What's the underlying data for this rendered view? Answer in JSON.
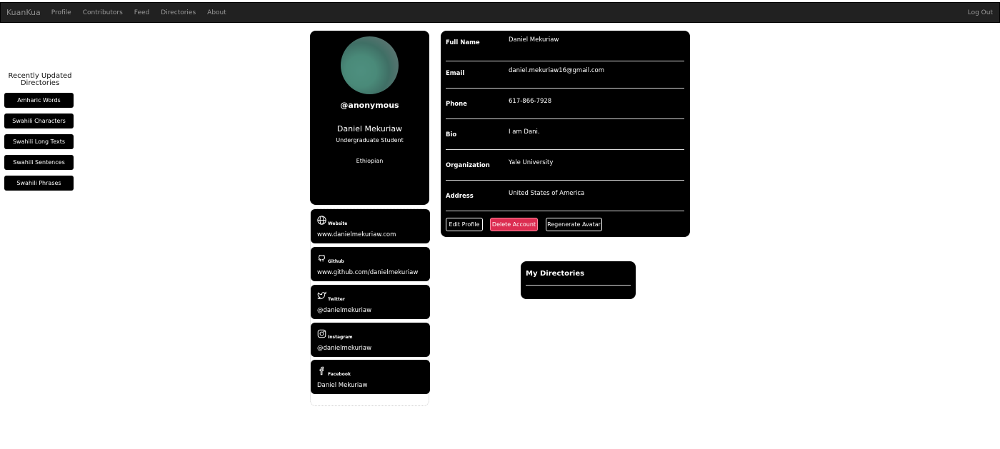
{
  "nav": {
    "brand": "KuanKua",
    "links": [
      "Profile",
      "Contributors",
      "Feed",
      "Directories",
      "About"
    ],
    "logout": "Log Out"
  },
  "sidebar": {
    "title": "Recently Updated Directories",
    "items": [
      "Amharic Words",
      "Swahili Characters",
      "Swahili Long Texts",
      "Swahili Sentences",
      "Swahili Phrases"
    ]
  },
  "profile": {
    "username": "@anonymous",
    "full_name": "Daniel Mekuriaw",
    "role": "Undergraduate Student",
    "nationality": "Ethiopian"
  },
  "social": [
    {
      "label": "Website",
      "value": "www.danielmekuriaw.com",
      "icon": "globe-icon"
    },
    {
      "label": "Github",
      "value": "www.github.com/danielmekuriaw",
      "icon": "github-icon"
    },
    {
      "label": "Twitter",
      "value": "@danielmekuriaw",
      "icon": "twitter-icon"
    },
    {
      "label": "Instagram",
      "value": "@danielmekuriaw",
      "icon": "instagram-icon"
    },
    {
      "label": "Facebook",
      "value": "Daniel Mekuriaw",
      "icon": "facebook-icon"
    }
  ],
  "details": [
    {
      "key": "Full Name",
      "value": "Daniel Mekuriaw"
    },
    {
      "key": "Email",
      "value": "daniel.mekuriaw16@gmail.com"
    },
    {
      "key": "Phone",
      "value": "617-866-7928"
    },
    {
      "key": "Bio",
      "value": "I am Dani."
    },
    {
      "key": "Organization",
      "value": "Yale University"
    },
    {
      "key": "Address",
      "value": "United States of America"
    }
  ],
  "actions": {
    "edit": "Edit Profile",
    "delete": "Delete Account",
    "regenerate": "Regenerate Avatar"
  },
  "my_directories": {
    "title": "My Directories"
  },
  "colors": {
    "navbar_bg": "#212121",
    "card_bg": "#000000",
    "danger": "#dc2d51",
    "avatar": "#4e8f7f"
  }
}
